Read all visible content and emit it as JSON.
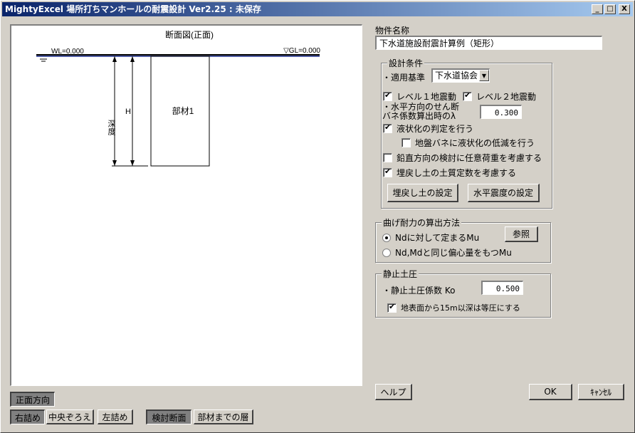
{
  "window": {
    "title": "MightyExcel 場所打ちマンホールの耐震設計 Ver2.25 : 未保存",
    "minimize": "_",
    "maximize": "□",
    "close": "X"
  },
  "drawing": {
    "title": "断面図(正面)",
    "wl_label": "WL=0.000",
    "gl_label": "▽GL=0.000",
    "depth_label": "深度",
    "h_label": "H",
    "member_label": "部材1"
  },
  "bottom_controls": {
    "direction_label": "正面方向",
    "right_align": "右詰め",
    "center_align": "中央ぞろえ",
    "left_align": "左詰め",
    "check_section": "検討断面",
    "layers_to_member": "部材までの層"
  },
  "project": {
    "label": "物件名称",
    "value": "下水道施設耐震計算例（矩形）"
  },
  "design_conditions": {
    "title": "設計条件",
    "standard_label": "・適用基準",
    "standard_value": "下水道協会",
    "level1": "レベル１地震動",
    "level2": "レベル２地震動",
    "shear_spring_label_1": "・水平方向のせん断",
    "shear_spring_label_2": "バネ係数算出時のλ",
    "shear_spring_value": "0.300",
    "liquefaction": "液状化の判定を行う",
    "liquefaction_reduce": "地盤バネに液状化の低減を行う",
    "vertical_load": "鉛直方向の検討に任意荷重を考慮する",
    "backfill_constants": "埋戻し土の土質定数を考慮する",
    "backfill_button": "埋戻し土の設定",
    "seismic_button": "水平震度の設定",
    "checks": {
      "level1": true,
      "level2": true,
      "liquefaction": true,
      "liquefaction_reduce": false,
      "vertical_load": false,
      "backfill_constants": true
    }
  },
  "bending": {
    "title": "曲げ耐力の算出方法",
    "option1": "Ndに対して定まるMu",
    "option2": "Nd,Mdと同じ偏心量をもつMu",
    "selected": 1,
    "reference_button": "参照"
  },
  "earth_pressure": {
    "title": "静止土圧",
    "coef_label": "・静止土圧係数 Ko",
    "coef_value": "0.500",
    "uniform_label": "地表面から15m以深は等圧にする",
    "uniform_checked": true
  },
  "footer": {
    "help": "ヘルプ",
    "ok": "OK",
    "cancel": "ｷｬﾝｾﾙ"
  }
}
